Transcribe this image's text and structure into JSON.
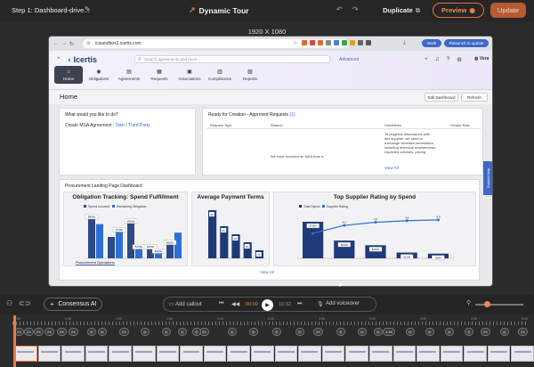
{
  "topbar": {
    "step_label": "Step 1: Dashboard-drive...",
    "tour_title": "Dynamic Tour",
    "duplicate_label": "Duplicate",
    "preview_label": "Preview",
    "update_label": "Update"
  },
  "resolution_label": "1920 X 1080",
  "browser": {
    "url": "icisandbox2.icertis.com",
    "work_label": "Work",
    "relaunch_label": "Relaunch to update"
  },
  "app": {
    "logo_text": "Icertis",
    "search_placeholder": "Search agreements and more...",
    "advanced_label": "Advanced",
    "user_label": "Vera",
    "nav": [
      {
        "label": "Home",
        "icon": "home-icon"
      },
      {
        "label": "Obligations",
        "icon": "obligations-icon"
      },
      {
        "label": "Agreements",
        "icon": "agreements-icon"
      },
      {
        "label": "Requests",
        "icon": "requests-icon"
      },
      {
        "label": "Associations",
        "icon": "associations-icon"
      },
      {
        "label": "Compliances",
        "icon": "compliances-icon"
      },
      {
        "label": "Reports",
        "icon": "reports-icon"
      }
    ],
    "page_title": "Home",
    "edit_dashboard_label": "Edit Dashboard",
    "refresh_label": "Refresh",
    "card1": {
      "title": "What would you like to do?",
      "prompt": "Create MSA Agreement :",
      "option_own": "Own",
      "separator": "/",
      "option_third": "Third Party"
    },
    "card2": {
      "title": "Ready for Creation - Approved Requests",
      "count": "(1)",
      "columns": [
        "Request Type",
        "Reason",
        "Guidelines",
        "Vendor Risk"
      ],
      "reason_text": "We have received an NDA from a",
      "guidelines_text": [
        "To progress discussions with",
        "this supplier, we need to",
        "exchange sensitive information,",
        "including technical requirements,",
        "expected volumes, pricing"
      ],
      "view_all": "View All"
    },
    "card3": {
      "title": "Procurement Landing Page Dashboard",
      "view_all": "View All",
      "tab_label": "Procurement Operations"
    },
    "guided_help": "Guided Help"
  },
  "chart_data": [
    {
      "type": "bar",
      "title": "Obligation Tracking: Spend Fulfillment",
      "series": [
        {
          "name": "Spend Incurred",
          "color": "#2e4a86",
          "values": [
            1.0,
            0.5,
            0.9,
            0.3,
            0.4
          ]
        },
        {
          "name": "Remaining Obligation",
          "color": "#2d6fd6",
          "values": [
            0.8,
            0.7,
            0.3,
            0.2,
            0.6
          ]
        }
      ],
      "data_labels": [
        "$800k",
        "$700k",
        "$900k",
        "$300k",
        "$600k",
        "$150k",
        "$200k"
      ]
    },
    {
      "type": "bar",
      "title": "Average Payment Terms",
      "ylim": [
        0,
        90
      ],
      "series": [
        {
          "name": "Days",
          "color": "#1f3a78",
          "values": [
            90,
            60,
            45,
            30,
            15
          ]
        }
      ]
    },
    {
      "type": "bar",
      "title": "Top Supplier Rating by Spend",
      "series": [
        {
          "name": "Total Spend",
          "color": "#1f3a78",
          "values": [
            700,
            340,
            250,
            110,
            90
          ]
        },
        {
          "name": "Supplier Rating",
          "color": "#2d6fd6",
          "values": [
            3.2,
            4.2,
            4.6,
            4.8,
            4.9
          ]
        }
      ],
      "data_labels": [
        "$700k",
        "$340k",
        "$250k",
        "$110k",
        "$90k"
      ]
    }
  ],
  "bottom": {
    "consensus_label": "Consensus AI",
    "add_callout_label": "Add callout",
    "time_current": "00:00",
    "time_total": "10:32",
    "add_voiceover_label": "Add voiceover"
  },
  "timeline": {
    "ruler": [
      "0:00",
      "0:30",
      "1:00",
      "1:30",
      "2:00",
      "2:30",
      "3:00",
      "3:30",
      "4:00",
      "4:30",
      "5:00"
    ],
    "badges": [
      "2X",
      "2X",
      "2X",
      "2X",
      "2X",
      "2X",
      "2X",
      "2X",
      "2X",
      "1.5X",
      "2X",
      "2X"
    ]
  }
}
